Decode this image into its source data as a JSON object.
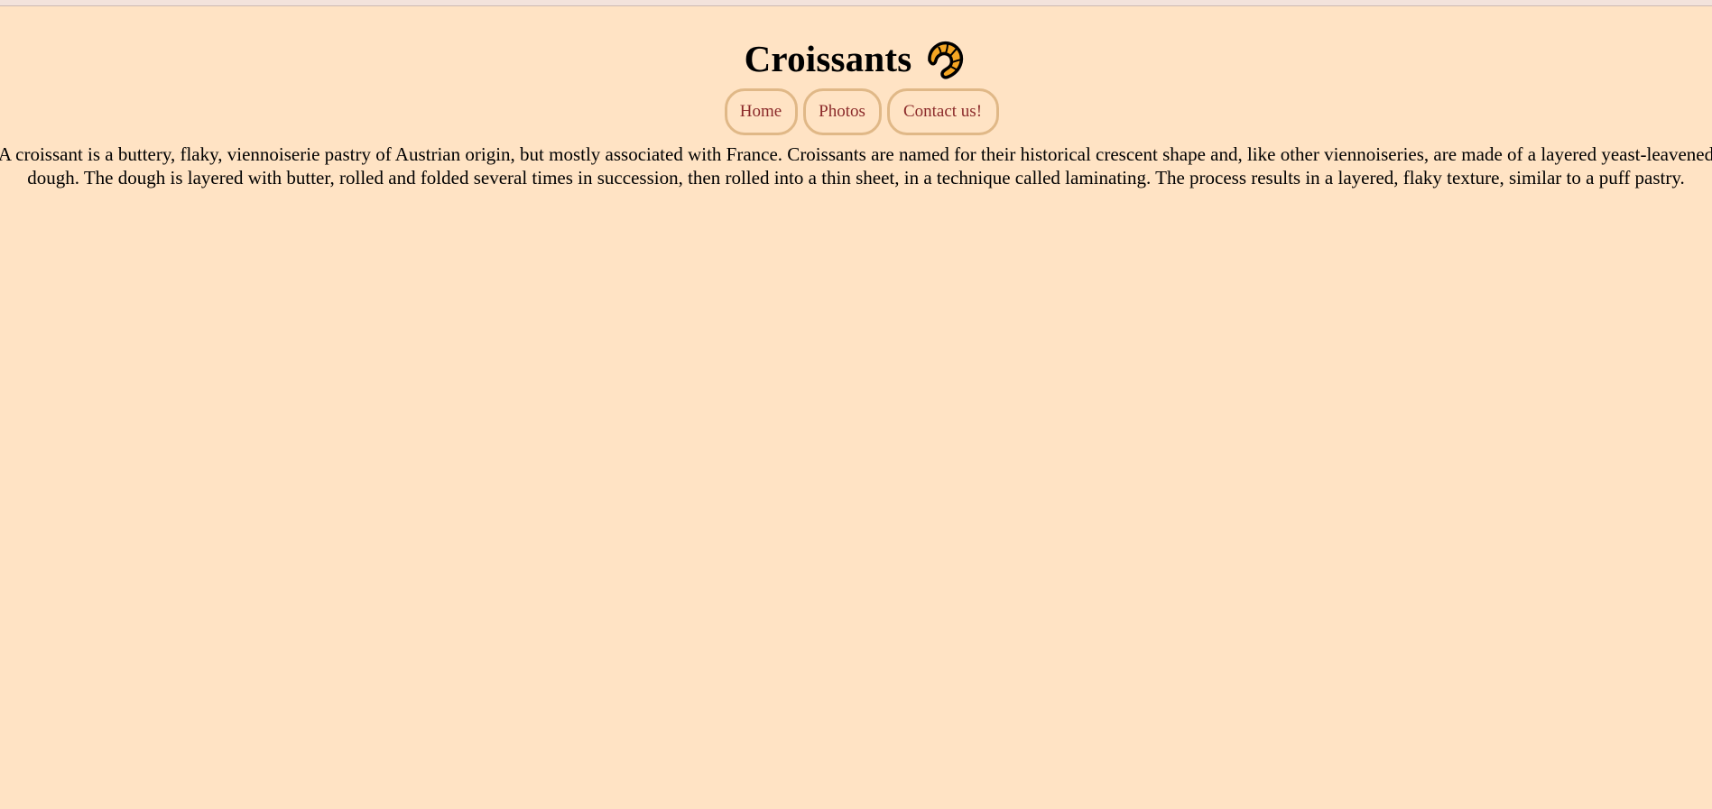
{
  "header": {
    "title": "Croissants",
    "icon": "croissant-icon"
  },
  "nav": {
    "items": [
      {
        "label": "Home"
      },
      {
        "label": "Photos"
      },
      {
        "label": "Contact us!"
      }
    ]
  },
  "main": {
    "description": "A croissant is a buttery, flaky, viennoiserie pastry of Austrian origin, but mostly associated with France. Croissants are named for their historical crescent shape and, like other viennoiseries, are made of a layered yeast-leavened dough. The dough is layered with butter, rolled and folded several times in succession, then rolled into a thin sheet, in a technique called laminating. The process results in a layered, flaky texture, similar to a puff pastry."
  },
  "colors": {
    "background": "#ffe3c4",
    "nav_text": "#8b2a2a",
    "nav_border": "#e0b887",
    "icon_fill": "#f5a623",
    "icon_outline": "#000000"
  }
}
